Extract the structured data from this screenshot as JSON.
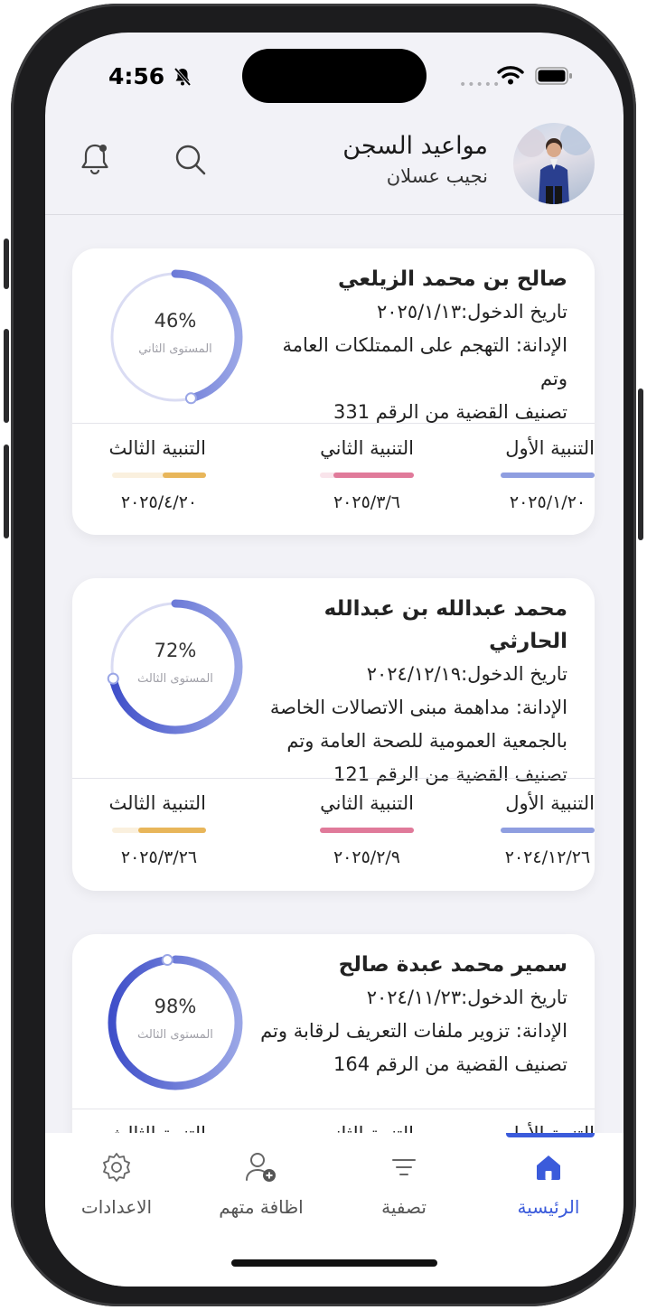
{
  "status_bar": {
    "time": "4:56"
  },
  "header": {
    "title": "مواعيد السجن",
    "subtitle": "نجيب عسلان"
  },
  "cards": [
    {
      "name": "صالح بن محمد الزيلعي",
      "entry": "تاريخ الدخول:٢٠٢٥/١/١٣",
      "charge_lines": [
        "الإدانة:  التهجم على الممتلكات العامة وتم",
        "تصنيف القضية من الرقم 331"
      ],
      "percent": "46%",
      "percent_value": 46,
      "level": "المستوى الثاني",
      "warnings": [
        {
          "label": "التنبية الأول",
          "date": "٢٠٢٥/١/٢٠",
          "fill": 1.0,
          "color": "#8f9ee0"
        },
        {
          "label": "التنبية الثاني",
          "date": "٢٠٢٥/٣/٦",
          "fill": 0.86,
          "color": "#e07a9a"
        },
        {
          "label": "التنبية الثالث",
          "date": "٢٠٢٥/٤/٢٠",
          "fill": 0.46,
          "color": "#e8b65a"
        }
      ]
    },
    {
      "name": "محمد عبدالله بن عبدالله الحارثي",
      "entry": "تاريخ الدخول:٢٠٢٤/١٢/١٩",
      "charge_lines": [
        "الإدانة:  مداهمة مبنى الاتصالات الخاصة",
        "بالجمعية العمومية للصحة العامة وتم",
        "تصنيف القضية من الرقم 121"
      ],
      "percent": "72%",
      "percent_value": 72,
      "level": "المستوى الثالث",
      "warnings": [
        {
          "label": "التنبية الأول",
          "date": "٢٠٢٤/١٢/٢٦",
          "fill": 1.0,
          "color": "#8f9ee0"
        },
        {
          "label": "التنبية الثاني",
          "date": "٢٠٢٥/٢/٩",
          "fill": 1.0,
          "color": "#e07a9a"
        },
        {
          "label": "التنبية الثالث",
          "date": "٢٠٢٥/٣/٢٦",
          "fill": 0.72,
          "color": "#e8b65a"
        }
      ]
    },
    {
      "name": "سمير محمد عبدة صالح",
      "entry": "تاريخ الدخول:٢٠٢٤/١١/٢٣",
      "charge_lines": [
        "الإدانة:  تزوير ملفات التعريف لرقابة وتم",
        "تصنيف القضية من الرقم 164"
      ],
      "percent": "98%",
      "percent_value": 98,
      "level": "المستوى الثالث",
      "warnings": [
        {
          "label": "التنبية الأول",
          "date": "",
          "fill": 1.0,
          "color": "#8f9ee0"
        },
        {
          "label": "التنبية الثاني",
          "date": "",
          "fill": 1.0,
          "color": "#e07a9a"
        },
        {
          "label": "التنبية الثالث",
          "date": "",
          "fill": 1.0,
          "color": "#e8b65a"
        }
      ]
    }
  ],
  "tabs": [
    {
      "label": "الرئيسية",
      "icon": "home-icon",
      "active": true
    },
    {
      "label": "تصفية",
      "icon": "filter-icon",
      "active": false
    },
    {
      "label": "اظافة متهم",
      "icon": "add-person-icon",
      "active": false
    },
    {
      "label": "الاعدادات",
      "icon": "gear-icon",
      "active": false
    }
  ],
  "colors": {
    "accent": "#3b5bdb",
    "ring_dark": "#3f4fc9",
    "ring_light": "#9aa6e6",
    "ring_track": "#dadcf3"
  }
}
